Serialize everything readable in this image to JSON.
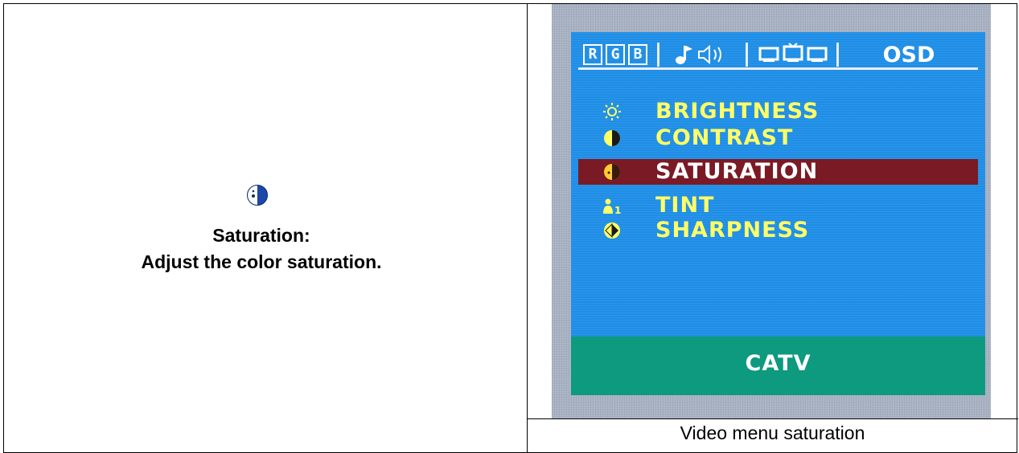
{
  "left_panel": {
    "icon": "saturation-icon",
    "title": "Saturation:",
    "description": "Adjust the color saturation."
  },
  "osd": {
    "tabs": [
      {
        "id": "rgb",
        "icon": "rgb-icon",
        "letters": [
          "R",
          "G",
          "B"
        ]
      },
      {
        "id": "audio",
        "icon": "audio-icon",
        "glyphs": "♪ ◁ ))"
      },
      {
        "id": "video",
        "icon": "video-icon",
        "glyphs": "▭▭▭"
      },
      {
        "id": "osd",
        "label": "OSD"
      }
    ],
    "menu": [
      {
        "icon": "brightness-icon",
        "label": "BRIGHTNESS",
        "selected": false
      },
      {
        "icon": "contrast-icon",
        "label": "CONTRAST",
        "selected": false
      },
      {
        "icon": "saturation-icon",
        "label": "SATURATION",
        "selected": true
      },
      {
        "icon": "tint-icon",
        "label": "TINT",
        "selected": false
      },
      {
        "icon": "sharpness-icon",
        "label": "SHARPNESS",
        "selected": false
      }
    ],
    "footer": "CATV",
    "colors": {
      "screen": "#1f8ee6",
      "label": "#ffff66",
      "selected_row": "#7a1a24",
      "footer": "#0d9a7e"
    }
  },
  "caption": "Video menu saturation"
}
